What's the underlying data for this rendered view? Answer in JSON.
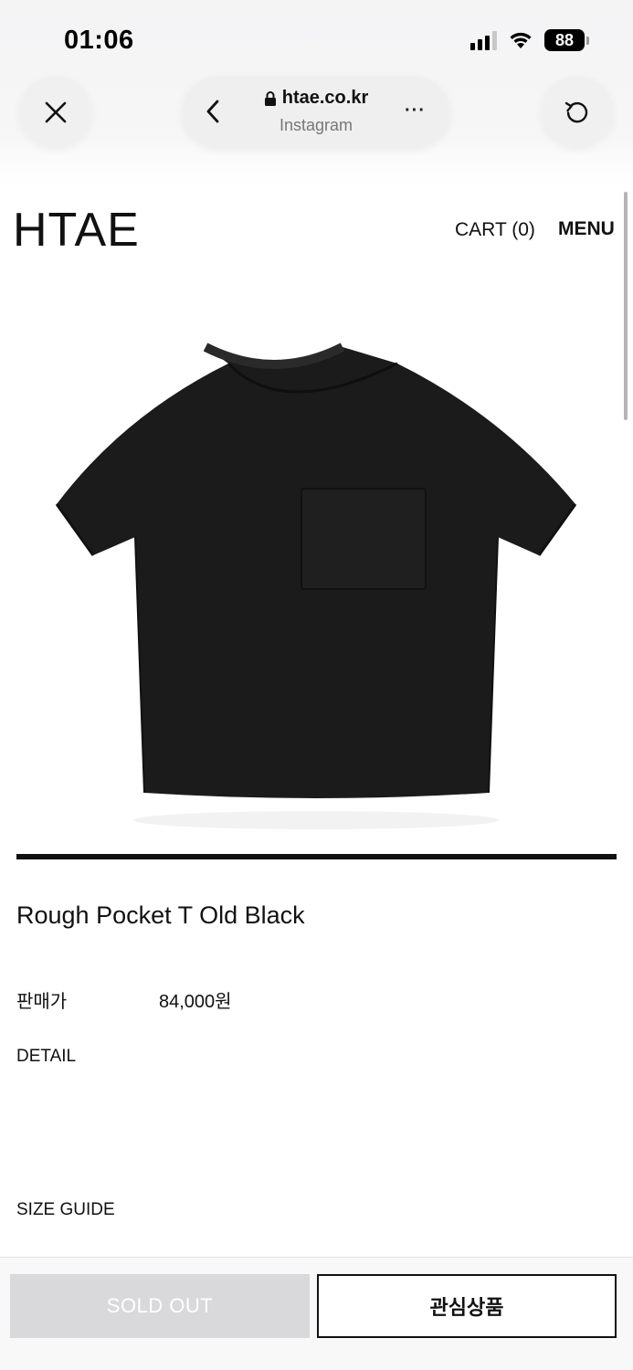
{
  "status_bar": {
    "time": "01:06",
    "battery": "88"
  },
  "browser": {
    "domain": "htae.co.kr",
    "source": "Instagram",
    "more_label": "···"
  },
  "site": {
    "logo": "HTAE",
    "cart_label": "CART (0)",
    "menu_label": "MENU"
  },
  "product": {
    "name": "Rough Pocket T Old Black",
    "price_label": "판매가",
    "price_value": "84,000원",
    "detail_label": "DETAIL",
    "size_guide_label": "SIZE GUIDE",
    "image_color": "#1a1a1a"
  },
  "actions": {
    "sold_out_label": "SOLD OUT",
    "wishlist_label": "관심상품"
  },
  "icons": {
    "close": "close-icon",
    "back": "chevron-left-icon",
    "lock": "lock-icon",
    "reload": "reload-icon"
  }
}
